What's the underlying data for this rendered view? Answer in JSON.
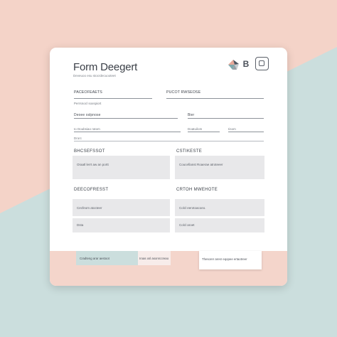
{
  "colors": {
    "background_peach": "#f4d3c8",
    "background_teal": "#cbdedd",
    "card": "#ffffff",
    "field_box": "#e8e8ea",
    "text_dark": "#3a3f47"
  },
  "header": {
    "title": "Form Deegert",
    "subtitle": "Deveuoo esu stocrdecuooteet",
    "logo_icon": "geometric-logo-icon",
    "b_button_label": "B",
    "square_icon": "window-icon"
  },
  "row1": {
    "left_label": "PACEOFEAETS",
    "left_sub": "Perrsnocl soxspiort",
    "right_label": "PUCOT RWSEOSE"
  },
  "row2": {
    "left_label": "Deoee oslpnose",
    "right_label": "Bier"
  },
  "row3": {
    "left_label": "Io Doubsiao ratom",
    "right_a": "Doatuilom",
    "right_b": "Iisom",
    "left_sub": "Drorc"
  },
  "section1": {
    "left_title": "BHCSEFSSOT",
    "left_hint": "Oraatl lerrt aw an portt",
    "right_title": "CSTIKESTE",
    "right_hint": "Coucefianst Roaerae atroteeer"
  },
  "section2": {
    "left_title": "DEECOFRESST",
    "left_hint_1": "Cecfeom atocteer",
    "left_hint_2": "Dsta",
    "right_title": "CRTOH MWEHOTE",
    "right_hint_1": "Colcl eerotoacoeo.",
    "right_hint_2": "Colcl aroet"
  },
  "footer": {
    "teal_text": "Cradteng arar aestoot",
    "white_text": "Iroas osl asonrccreao",
    "card_text": "Thesorer aresr eqopee ertaotreer"
  }
}
